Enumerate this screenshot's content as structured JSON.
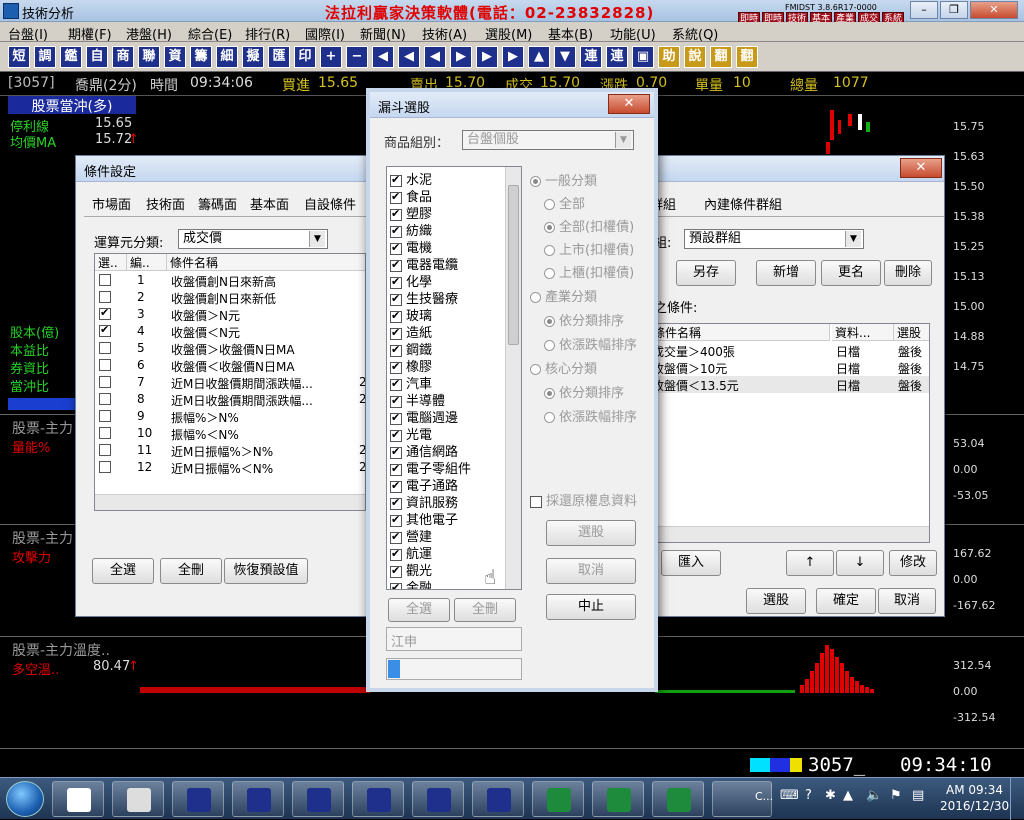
{
  "app": {
    "title": "技術分析",
    "banner": "法拉利贏家決策軟體(電話：02-23832828)",
    "version": "FMIDST 3.8.6R17-0000",
    "quick_buttons": [
      "即時\n行情",
      "即時\n新聞",
      "技術\n分析",
      "基本\n分析",
      "產業\n分析",
      "成交\n明細",
      "系統\n設定"
    ]
  },
  "menu": [
    "台盤(I)",
    "期權(F)",
    "港盤(H)",
    "綜合(E)",
    "排行(R)",
    "國際(I)",
    "新聞(N)",
    "技術(A)",
    "選股(M)",
    "基本(B)",
    "功能(U)",
    "系統(Q)"
  ],
  "toolbar": [
    "短",
    "調",
    "鑑",
    "自",
    "商",
    "聯",
    "資",
    "籌",
    "細",
    "擬",
    "匯",
    "印",
    "+",
    "−",
    "◀",
    "◀",
    "◀",
    "▶",
    "▶",
    "▶",
    "▲",
    "▼",
    "連",
    "連",
    "▣",
    "助",
    "說",
    "翻",
    "翻"
  ],
  "infobar": {
    "code": "[3057]",
    "name": "喬鼎(2分)",
    "time_label": "時間",
    "time": "09:34:06",
    "buy_label": "買進",
    "buy": "15.65",
    "sell_label": "賣出",
    "sell": "15.70",
    "deal_label": "成交",
    "deal": "15.70",
    "change_label": "漲跌",
    "change": "0.70",
    "vol_label": "單量",
    "vol": "10",
    "total_label": "總量",
    "total": "1077"
  },
  "left_panel": {
    "header": "股票當沖(多)",
    "stop_label": "停利線",
    "stop_value": "15.65",
    "ma_label": "均價MA",
    "ma_value": "15.72",
    "ma_arrow": "↑",
    "hidden_value": "0.00",
    "lower_labels": [
      "股本(億)",
      "本益比",
      "券資比",
      "當沖比"
    ]
  },
  "price_axis": [
    "15.75",
    "15.63",
    "15.50",
    "15.38",
    "15.25",
    "15.13",
    "15.00",
    "14.88",
    "14.75"
  ],
  "panel2": {
    "title": "股票-主力",
    "sub": "量能%",
    "axis": [
      "53.04",
      "0.00",
      "-53.05"
    ]
  },
  "panel3": {
    "title": "股票-主力",
    "sub": "攻擊力",
    "axis": [
      "167.62",
      "0.00",
      "-167.62"
    ]
  },
  "panel4": {
    "title": "股票-主力溫度..",
    "sub": "多空溫..",
    "value": "80.47",
    "arrow": "↑",
    "axis": [
      "312.54",
      "0.00",
      "-312.54"
    ]
  },
  "status": {
    "code": "3057_",
    "time": "09:34:10"
  },
  "condition_dialog": {
    "title": "條件設定",
    "tabs": [
      "市場面",
      "技術面",
      "籌碼面",
      "基本面",
      "自設條件",
      "群組",
      "內建條件群組"
    ],
    "calc_label": "運算元分類:",
    "calc_value": "成交價",
    "columns": [
      "選..",
      "編..",
      "條件名稱"
    ],
    "rows": [
      {
        "checked": false,
        "no": "1",
        "name": "收盤價創N日來新高",
        "extra": ""
      },
      {
        "checked": false,
        "no": "2",
        "name": "收盤價創N日來新低",
        "extra": ""
      },
      {
        "checked": true,
        "no": "3",
        "name": "收盤價＞N元",
        "extra": ""
      },
      {
        "checked": true,
        "no": "4",
        "name": "收盤價＜N元",
        "extra": ""
      },
      {
        "checked": false,
        "no": "5",
        "name": "收盤價＞收盤價N日MA",
        "extra": ""
      },
      {
        "checked": false,
        "no": "6",
        "name": "收盤價＜收盤價N日MA",
        "extra": ""
      },
      {
        "checked": false,
        "no": "7",
        "name": "近M日收盤價期間漲跌幅...",
        "extra": "2"
      },
      {
        "checked": false,
        "no": "8",
        "name": "近M日收盤價期間漲跌幅...",
        "extra": "2"
      },
      {
        "checked": false,
        "no": "9",
        "name": "振幅%＞N%",
        "extra": ""
      },
      {
        "checked": false,
        "no": "10",
        "name": "振幅%＜N%",
        "extra": ""
      },
      {
        "checked": false,
        "no": "11",
        "name": "近M日振幅%＞N%",
        "extra": "2"
      },
      {
        "checked": false,
        "no": "12",
        "name": "近M日振幅%＜N%",
        "extra": "2"
      }
    ],
    "group_label": "組:",
    "group_value": "預設群組",
    "group_buttons": [
      "另存",
      "新增",
      "更名",
      "刪除"
    ],
    "selected_label": "之條件:",
    "sel_columns": [
      "條件名稱",
      "資料...",
      "選股"
    ],
    "sel_rows": [
      {
        "name": "成交量＞400張",
        "data": "日檔",
        "pick": "盤後"
      },
      {
        "name": "收盤價＞10元",
        "data": "日檔",
        "pick": "盤後"
      },
      {
        "name": "收盤價＜13.5元",
        "data": "日檔",
        "pick": "盤後"
      }
    ],
    "bottom_left": [
      "全選",
      "全刪",
      "恢復預設值"
    ],
    "import_label": "匯入",
    "up": "↑",
    "down": "↓",
    "modify": "修改",
    "bottom_right": [
      "選股",
      "確定",
      "取消"
    ]
  },
  "funnel_dialog": {
    "title": "漏斗選股",
    "product_label": "商品組別：",
    "product_value": "台盤個股",
    "industries": [
      "水泥",
      "食品",
      "塑膠",
      "紡織",
      "電機",
      "電器電纜",
      "化學",
      "生技醫療",
      "玻璃",
      "造紙",
      "鋼鐵",
      "橡膠",
      "汽車",
      "半導體",
      "電腦週邊",
      "光電",
      "通信網路",
      "電子零組件",
      "電子通路",
      "資訊服務",
      "其他電子",
      "營建",
      "航運",
      "觀光",
      "金融"
    ],
    "radio_general": "一般分類",
    "radio_all": "全部",
    "radio_all_ex": "全部(扣權債)",
    "radio_listed": "上市(扣權債)",
    "radio_otc": "上櫃(扣權債)",
    "radio_industry": "產業分類",
    "radio_sort_cat": "依分類排序",
    "radio_sort_chg": "依漲跌幅排序",
    "radio_core": "核心分類",
    "radio_sort_cat2": "依分類排序",
    "radio_sort_chg2": "依漲跌幅排序",
    "restore_label": "採還原權息資料",
    "btn_pick": "選股",
    "btn_cancel": "取消",
    "btn_stop": "中止",
    "btn_all": "全選",
    "btn_clear": "全刪",
    "current_item": "江申"
  },
  "taskbar": {
    "time": "AM 09:34",
    "date": "2016/12/30",
    "app_label": "C..."
  }
}
